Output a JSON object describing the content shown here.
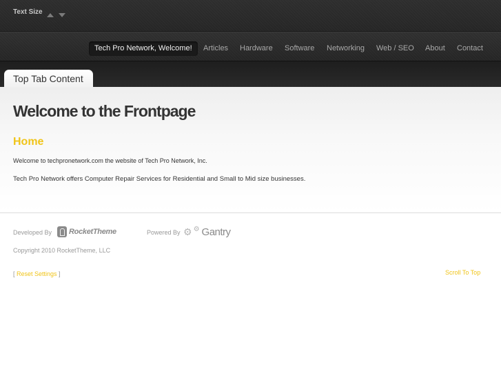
{
  "header": {
    "text_size_label": "Text Size"
  },
  "nav": {
    "items": [
      {
        "label": "Tech Pro Network, Welcome!"
      },
      {
        "label": "Articles"
      },
      {
        "label": "Hardware"
      },
      {
        "label": "Software"
      },
      {
        "label": "Networking"
      },
      {
        "label": "Web / SEO"
      },
      {
        "label": "About"
      },
      {
        "label": "Contact"
      }
    ],
    "active_color": "#1a1a1a",
    "text_color": "#a9a9a9"
  },
  "tab": {
    "label": "Top Tab Content"
  },
  "main": {
    "title": "Welcome to the Frontpage",
    "section_title": "Home",
    "paragraph1": "Welcome to techpronetwork.com  the website of Tech Pro Network, Inc.",
    "paragraph2": "Tech Pro Network offers Computer Repair Services for Residential and Small to Mid size businesses.",
    "accent_color": "#f0c419"
  },
  "footer": {
    "developed_by_label": "Developed By",
    "developer_logo_text": "RocketTheme",
    "powered_by_label": "Powered By",
    "powered_logo_text": "Gantry",
    "copyright": "Copyright 2010 RocketTheme, LLC",
    "reset_open": "[ ",
    "reset_label": "Reset Settings",
    "reset_close": " ]",
    "scroll_top_label": "Scroll To Top"
  },
  "icons": {
    "text_size_up": "triangle-up-icon",
    "text_size_down": "triangle-down-icon",
    "rockettheme_logo": "rockettheme-logo-icon",
    "gantry_logo": "gear-icon"
  }
}
